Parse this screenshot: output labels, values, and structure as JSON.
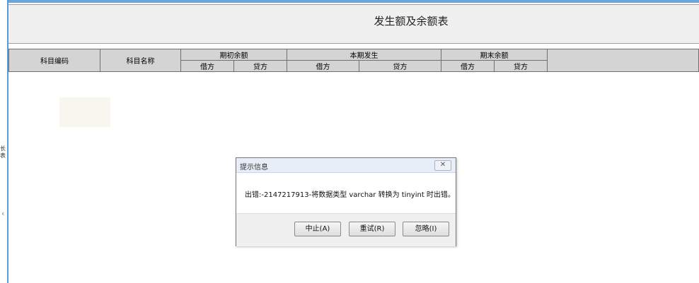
{
  "report": {
    "title": "发生额及余额表"
  },
  "table_header": {
    "col_code": "科目编码",
    "col_name": "科目名称",
    "groups": [
      "期初余额",
      "本期发生",
      "期末余额"
    ],
    "sub": [
      "借方",
      "贷方",
      "借方",
      "贷方",
      "借方",
      "贷方"
    ]
  },
  "left_strip": {
    "fragment": "长 表",
    "chevron": "‹"
  },
  "dialog": {
    "title": "提示信息",
    "close_glyph": "✕",
    "message": "出错:-2147217913-将数据类型 varchar 转换为 tinyint 时出错。",
    "buttons": [
      "中止(A)",
      "重试(R)",
      "忽略(I)"
    ]
  },
  "colors": {
    "accent": "#5b9bd5",
    "header_bg": "#d4d4d4",
    "panel_bg": "#f0f0f0"
  }
}
